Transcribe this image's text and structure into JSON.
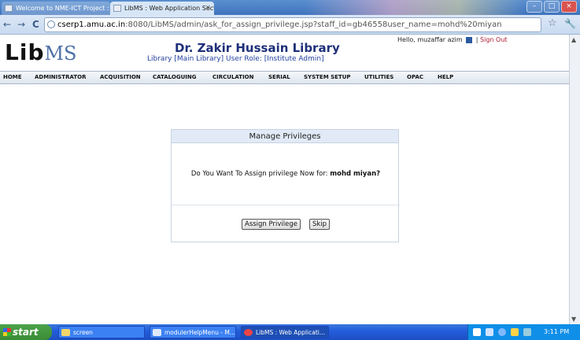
{
  "browser": {
    "tabs": [
      {
        "label": "Welcome to NME-ICT Project :",
        "close": "×"
      },
      {
        "label": "LibMS : Web Application Secti",
        "close": "×"
      }
    ],
    "url_host": "cserp1.amu.ac.in",
    "url_rest": ":8080/LibMS/admin/ask_for_assign_privilege.jsp?staff_id=gb46558user_name=mohd%20miyan",
    "nav": {
      "back": "←",
      "forward": "→",
      "reload": "C"
    },
    "star": "☆",
    "wrench": "🔧"
  },
  "site": {
    "logo_lib": "Lib",
    "logo_ms": "MS",
    "title": "Dr. Zakir Hussain Library",
    "subtitle": "Library [Main Library]  User Role: [Institute Admin]",
    "user_greeting": "Hello,  muzaffar azim",
    "sign_out": "Sign Out",
    "separator": "|"
  },
  "menu": [
    "HOME",
    "ADMINISTRATOR",
    "ACQUISITION",
    "CATALOGUING",
    "CIRCULATION",
    "SERIAL",
    "SYSTEM SETUP",
    "UTILITIES",
    "OPAC",
    "HELP"
  ],
  "dialog": {
    "title": "Manage Privileges",
    "question": "Do You Want To Assign privilege Now for:",
    "user_name": "mohd miyan?",
    "assign_button": "Assign Privilege",
    "skip_button": "Skip"
  },
  "taskbar": {
    "start": "start",
    "tasks": [
      "screen",
      "modulerHelpMenu - M...",
      "LibMS : Web Applicati..."
    ],
    "clock": "3:11 PM"
  },
  "colors": {
    "title_blue": "#1e2f7a",
    "dialog_header": "#e1eaf6",
    "signout_red": "#b0192f",
    "taskbar_blue": "#245edb"
  }
}
